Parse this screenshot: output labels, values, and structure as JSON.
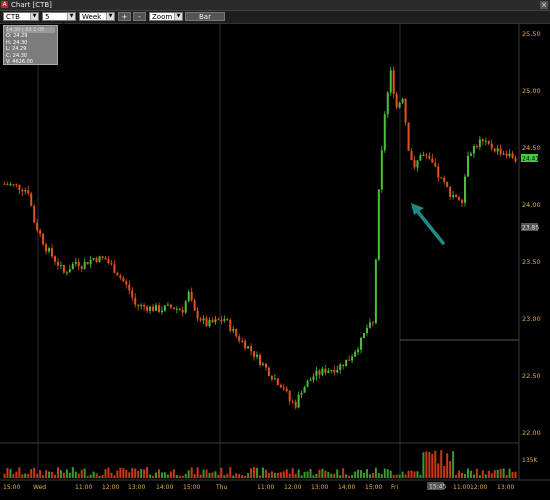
{
  "window": {
    "title": "Chart [CTB]",
    "icon": "app-chart-icon"
  },
  "toolbar": {
    "symbol": "CTB",
    "interval": "5 minutes",
    "range": "Week",
    "zoom_in": "+",
    "zoom_out": "-",
    "zoom": "Zoom",
    "bar_label": "Bar"
  },
  "ohlc_box": {
    "header": "14:30 | 03 1 05",
    "open": "O: 24.29",
    "high": "H: 24.30",
    "low": "L: 24.29",
    "close": "C: 24.30",
    "volume": "V: 4626.00"
  },
  "price_axis": {
    "labels": [
      "25.50",
      "25.00",
      "24.50",
      "24.00",
      "23.50",
      "23.00",
      "22.50",
      "22.00"
    ],
    "last_price_tag": "24.41",
    "cursor_tag": "23.85",
    "volume_label": "135K"
  },
  "time_axis": {
    "labels": [
      "15:00",
      "Wed",
      "11:00",
      "12:00",
      "13:00",
      "14:00",
      "15:00",
      "Thu",
      "11:00",
      "12:00",
      "13:00",
      "14:00",
      "15:00",
      "Fri",
      "11:00",
      "12:00",
      "13:00"
    ],
    "cursor_time": "15:45"
  },
  "colors": {
    "up": "#4cbf3a",
    "down": "#e0541e",
    "volume_up": "#3a9a2a",
    "volume_down": "#c63a1a",
    "arrow": "#1f8a86",
    "grid": "#2b2b2b"
  },
  "chart_data": {
    "type": "bar",
    "style": "candlestick",
    "ylim": [
      22.0,
      25.5
    ],
    "x": [
      "15:00",
      "Wed",
      "11:00",
      "12:00",
      "13:00",
      "14:00",
      "15:00",
      "Thu",
      "11:00",
      "12:00",
      "13:00",
      "14:00",
      "15:00",
      "Fri",
      "11:00",
      "12:00",
      "13:00"
    ],
    "close_path": [
      [
        0,
        24.18
      ],
      [
        2,
        24.16
      ],
      [
        4,
        24.12
      ],
      [
        5,
        23.85
      ],
      [
        7,
        23.62
      ],
      [
        9,
        23.48
      ],
      [
        10,
        23.4
      ],
      [
        12,
        23.5
      ],
      [
        13,
        23.47
      ],
      [
        15,
        23.53
      ],
      [
        17,
        23.52
      ],
      [
        19,
        23.4
      ],
      [
        21,
        23.25
      ],
      [
        22,
        23.12
      ],
      [
        24,
        23.1
      ],
      [
        26,
        23.08
      ],
      [
        28,
        23.1
      ],
      [
        30,
        23.08
      ],
      [
        31,
        23.22
      ],
      [
        32,
        23.05
      ],
      [
        34,
        22.95
      ],
      [
        36,
        22.98
      ],
      [
        37,
        23.0
      ],
      [
        39,
        22.85
      ],
      [
        41,
        22.75
      ],
      [
        43,
        22.63
      ],
      [
        45,
        22.5
      ],
      [
        47,
        22.4
      ],
      [
        48,
        22.28
      ],
      [
        49,
        22.25
      ],
      [
        50,
        22.38
      ],
      [
        52,
        22.5
      ],
      [
        54,
        22.55
      ],
      [
        56,
        22.57
      ],
      [
        58,
        22.65
      ],
      [
        60,
        22.8
      ],
      [
        61,
        22.92
      ],
      [
        62,
        22.95
      ],
      [
        63,
        24.1
      ],
      [
        64,
        24.8
      ],
      [
        65,
        25.15
      ],
      [
        66,
        24.85
      ],
      [
        67,
        24.95
      ],
      [
        68,
        24.5
      ],
      [
        69,
        24.3
      ],
      [
        70,
        24.45
      ],
      [
        72,
        24.35
      ],
      [
        73,
        24.25
      ],
      [
        75,
        24.1
      ],
      [
        77,
        24.05
      ],
      [
        78,
        24.45
      ],
      [
        80,
        24.55
      ],
      [
        82,
        24.5
      ],
      [
        84,
        24.45
      ],
      [
        86,
        24.4
      ]
    ],
    "volume_note": "volume spike at Friday open",
    "annotation": "arrow pointing to Friday opening gap"
  }
}
